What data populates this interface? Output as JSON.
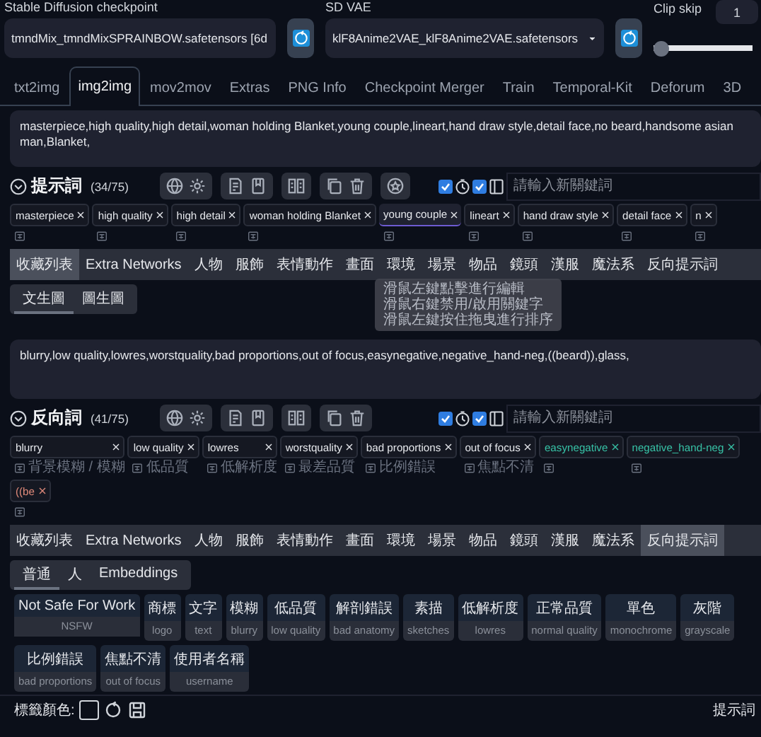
{
  "settings": {
    "checkpoint": {
      "label": "Stable Diffusion checkpoint",
      "value": "tmndMix_tmndMixSPRAINBOW.safetensors [6d"
    },
    "vae": {
      "label": "SD VAE",
      "value": "klF8Anime2VAE_klF8Anime2VAE.safetensors"
    },
    "clip_skip": {
      "label": "Clip skip",
      "value": "1",
      "level": 0
    }
  },
  "tabs": [
    {
      "label": "txt2img",
      "selected": false
    },
    {
      "label": "img2img",
      "selected": true
    },
    {
      "label": "mov2mov",
      "selected": false
    },
    {
      "label": "Extras",
      "selected": false
    },
    {
      "label": "PNG Info",
      "selected": false
    },
    {
      "label": "Checkpoint Merger",
      "selected": false
    },
    {
      "label": "Train",
      "selected": false
    },
    {
      "label": "Temporal-Kit",
      "selected": false
    },
    {
      "label": "Deforum",
      "selected": false
    },
    {
      "label": "3D",
      "selected": false
    }
  ],
  "prompt": {
    "text": "masterpiece,high quality,high detail,woman holding Blanket,young couple,lineart,hand draw style,detail face,no beard,handsome asian man,Blanket,",
    "title": "提示詞",
    "count": "(34/75)",
    "keyword_placeholder": "請輸入新關鍵詞",
    "toggles": [
      {
        "checked": true
      },
      {
        "checked": true
      }
    ],
    "tags": [
      {
        "label": "masterpiece",
        "kind": "normal",
        "selected": false
      },
      {
        "label": "high quality",
        "kind": "normal",
        "selected": false
      },
      {
        "label": "high detail",
        "kind": "normal",
        "selected": false
      },
      {
        "label": "woman holding Blanket",
        "kind": "normal",
        "selected": false
      },
      {
        "label": "young couple",
        "kind": "normal",
        "selected": true
      },
      {
        "label": "lineart",
        "kind": "normal",
        "selected": false
      },
      {
        "label": "hand draw style",
        "kind": "normal",
        "selected": false
      },
      {
        "label": "detail face",
        "kind": "normal",
        "selected": false
      },
      {
        "label": "n",
        "kind": "normal",
        "selected": false
      }
    ],
    "categories": [
      {
        "label": "收藏列表",
        "selected": true
      },
      {
        "label": "Extra Networks",
        "selected": false
      },
      {
        "label": "人物",
        "selected": false
      },
      {
        "label": "服飾",
        "selected": false
      },
      {
        "label": "表情動作",
        "selected": false
      },
      {
        "label": "畫面",
        "selected": false
      },
      {
        "label": "環境",
        "selected": false
      },
      {
        "label": "場景",
        "selected": false
      },
      {
        "label": "物品",
        "selected": false
      },
      {
        "label": "鏡頭",
        "selected": false
      },
      {
        "label": "漢服",
        "selected": false
      },
      {
        "label": "魔法系",
        "selected": false
      },
      {
        "label": "反向提示詞",
        "selected": false
      }
    ],
    "subtabs": [
      {
        "label": "文生圖",
        "selected": true
      },
      {
        "label": "圖生圖",
        "selected": false
      }
    ],
    "tooltip": [
      "滑鼠左鍵點擊進行編輯",
      "滑鼠右鍵禁用/啟用關鍵字",
      "滑鼠左鍵按住拖曳進行排序"
    ]
  },
  "negative": {
    "text": "blurry,low quality,lowres,worstquality,bad proportions,out of focus,easynegative,negative_hand-neg,((beard)),glass,",
    "title": "反向詞",
    "count": "(41/75)",
    "keyword_placeholder": "請輸入新關鍵詞",
    "toggles": [
      {
        "checked": true
      },
      {
        "checked": true
      }
    ],
    "tags": [
      {
        "label": "blurry",
        "kind": "normal",
        "selected": false,
        "translation": "背景模糊 / 模糊"
      },
      {
        "label": "low quality",
        "kind": "normal",
        "selected": false,
        "translation": "低品質"
      },
      {
        "label": "lowres",
        "kind": "normal",
        "selected": false,
        "translation": "低解析度"
      },
      {
        "label": "worstquality",
        "kind": "normal",
        "selected": false,
        "translation": "最差品質"
      },
      {
        "label": "bad proportions",
        "kind": "normal",
        "selected": false,
        "translation": "比例錯誤"
      },
      {
        "label": "out of focus",
        "kind": "normal",
        "selected": false,
        "translation": "焦點不清"
      },
      {
        "label": "easynegative",
        "kind": "embedding",
        "selected": false
      },
      {
        "label": "negative_hand-neg",
        "kind": "embedding",
        "selected": false
      },
      {
        "label": "((be",
        "kind": "weighted",
        "selected": false
      }
    ],
    "categories": [
      {
        "label": "收藏列表",
        "selected": false
      },
      {
        "label": "Extra Networks",
        "selected": false
      },
      {
        "label": "人物",
        "selected": false
      },
      {
        "label": "服飾",
        "selected": false
      },
      {
        "label": "表情動作",
        "selected": false
      },
      {
        "label": "畫面",
        "selected": false
      },
      {
        "label": "環境",
        "selected": false
      },
      {
        "label": "場景",
        "selected": false
      },
      {
        "label": "物品",
        "selected": false
      },
      {
        "label": "鏡頭",
        "selected": false
      },
      {
        "label": "漢服",
        "selected": false
      },
      {
        "label": "魔法系",
        "selected": false
      },
      {
        "label": "反向提示詞",
        "selected": true
      }
    ],
    "subtabs": [
      {
        "label": "普通",
        "selected": true
      },
      {
        "label": "人",
        "selected": false
      },
      {
        "label": "Embeddings",
        "selected": false
      }
    ],
    "chip_rows": [
      {
        "chips": [
          {
            "label": "Not Safe For Work",
            "sub": "NSFW"
          },
          {
            "label": "商標",
            "sub": "logo"
          },
          {
            "label": "文字",
            "sub": "text"
          },
          {
            "label": "模糊",
            "sub": "blurry"
          },
          {
            "label": "低品質",
            "sub": "low quality"
          },
          {
            "label": "解剖錯誤",
            "sub": "bad anatomy"
          },
          {
            "label": "素描",
            "sub": "sketches"
          },
          {
            "label": "低解析度",
            "sub": "lowres"
          },
          {
            "label": "正常品質",
            "sub": "normal quality"
          },
          {
            "label": "單色",
            "sub": "monochrome"
          },
          {
            "label": "灰階",
            "sub": "grayscale"
          }
        ]
      },
      {
        "chips": [
          {
            "label": "比例錯誤",
            "sub": "bad proportions"
          },
          {
            "label": "焦點不清",
            "sub": "out of focus"
          },
          {
            "label": "使用者名稱",
            "sub": "username"
          }
        ]
      }
    ]
  },
  "footer": {
    "label": "標籤顏色:",
    "right": "提示詞"
  }
}
